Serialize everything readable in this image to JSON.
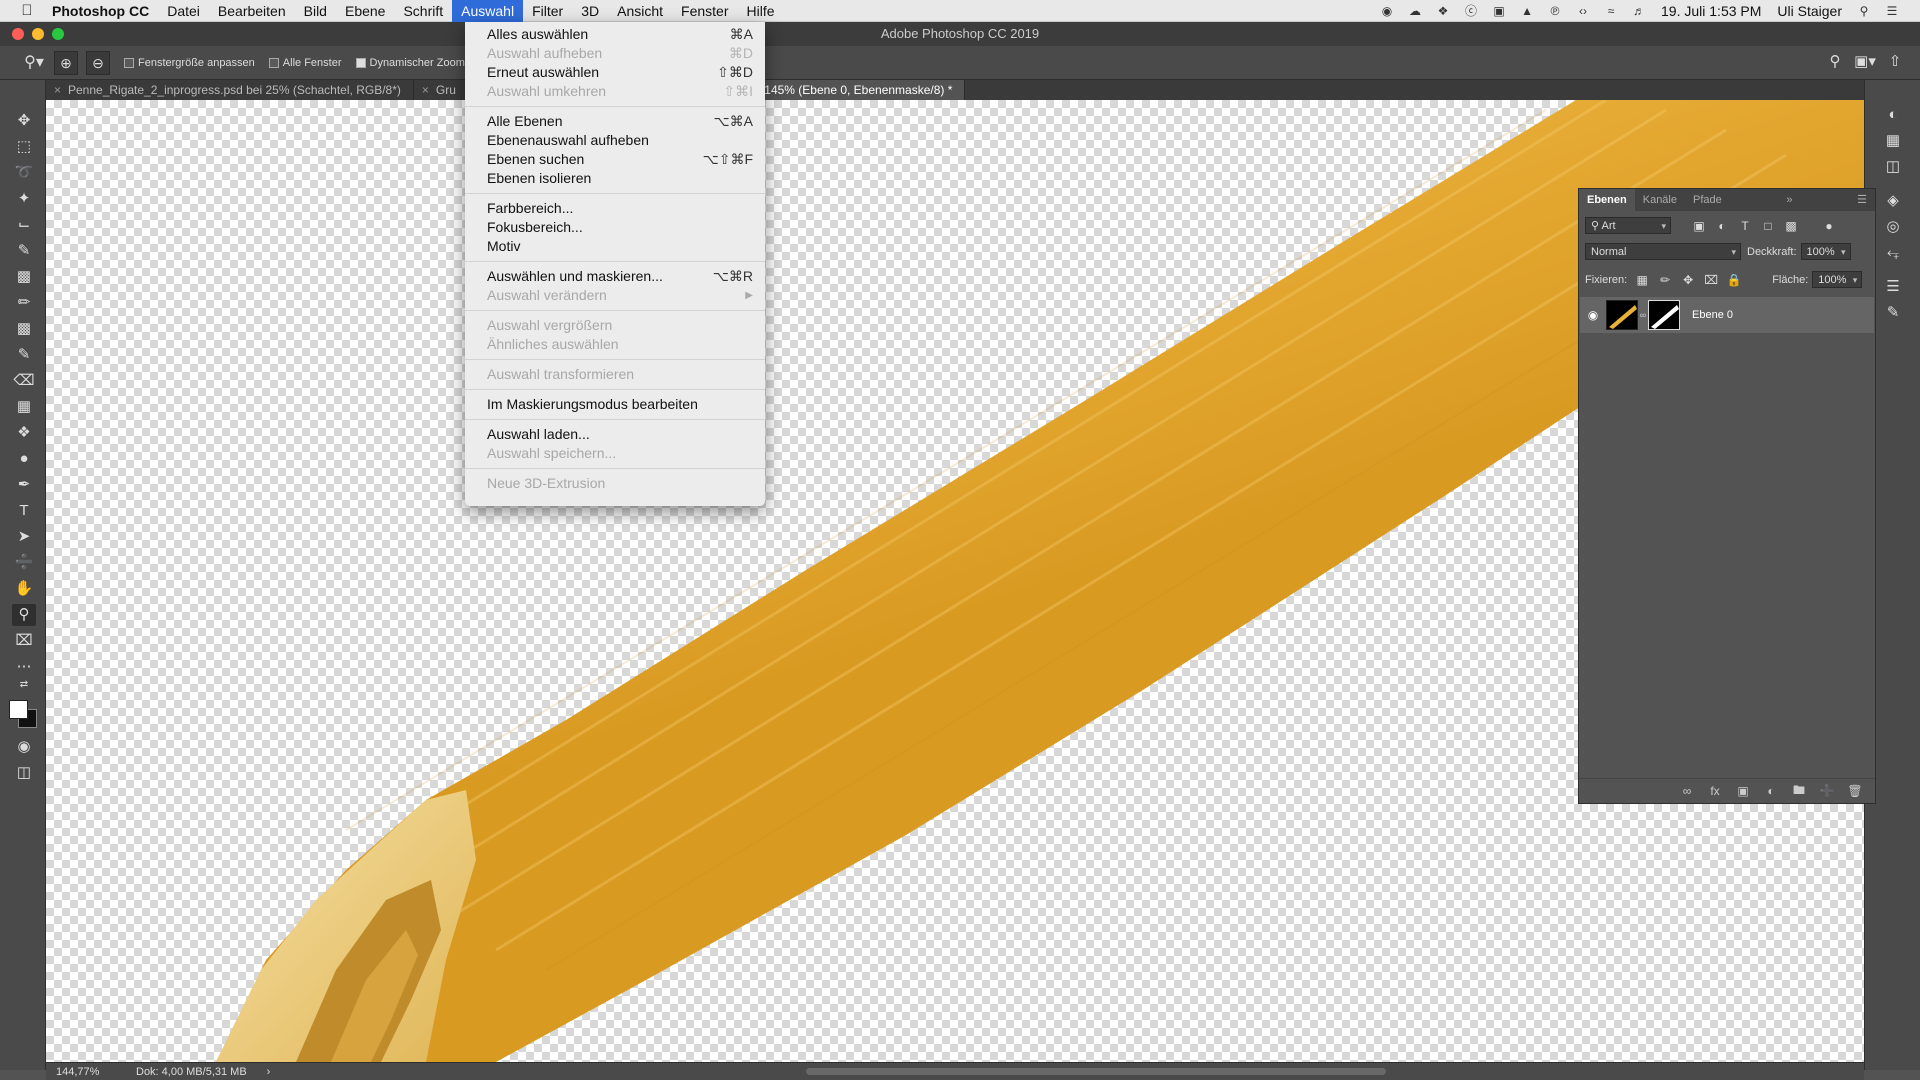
{
  "menubar": {
    "app": "Photoshop CC",
    "items": [
      "Datei",
      "Bearbeiten",
      "Bild",
      "Ebene",
      "Schrift",
      "Auswahl",
      "Filter",
      "3D",
      "Ansicht",
      "Fenster",
      "Hilfe"
    ],
    "datetime": "19. Juli  1:53 PM",
    "user": "Uli Staiger"
  },
  "window": {
    "title": "Adobe Photoshop CC 2019"
  },
  "options": {
    "fit_label": "Fenstergröße anpassen",
    "all_windows_label": "Alle Fenster",
    "scrubby_label": "Dynamischer Zoom"
  },
  "tabs": [
    {
      "label": "Penne_Rigate_2_inprogress.psd bei 25% (Schachtel, RGB/8*)"
    },
    {
      "label": "Gru"
    },
    {
      "label": "16.jpg bei 145% (Ebene 0, Ebenenmaske/8) *"
    }
  ],
  "menu": {
    "items": [
      {
        "label": "Alles auswählen",
        "shortcut": "⌘A",
        "enabled": true
      },
      {
        "label": "Auswahl aufheben",
        "shortcut": "⌘D",
        "enabled": false
      },
      {
        "label": "Erneut auswählen",
        "shortcut": "⇧⌘D",
        "enabled": true
      },
      {
        "label": "Auswahl umkehren",
        "shortcut": "⇧⌘I",
        "enabled": false
      },
      {
        "sep": true
      },
      {
        "label": "Alle Ebenen",
        "shortcut": "⌥⌘A",
        "enabled": true
      },
      {
        "label": "Ebenenauswahl aufheben",
        "shortcut": "",
        "enabled": true
      },
      {
        "label": "Ebenen suchen",
        "shortcut": "⌥⇧⌘F",
        "enabled": true
      },
      {
        "label": "Ebenen isolieren",
        "shortcut": "",
        "enabled": true
      },
      {
        "sep": true
      },
      {
        "label": "Farbbereich...",
        "shortcut": "",
        "enabled": true
      },
      {
        "label": "Fokusbereich...",
        "shortcut": "",
        "enabled": true
      },
      {
        "label": "Motiv",
        "shortcut": "",
        "enabled": true
      },
      {
        "sep": true
      },
      {
        "label": "Auswählen und maskieren...",
        "shortcut": "⌥⌘R",
        "enabled": true
      },
      {
        "label": "Auswahl verändern",
        "shortcut": "",
        "enabled": false,
        "submenu": true
      },
      {
        "sep": true
      },
      {
        "label": "Auswahl vergrößern",
        "shortcut": "",
        "enabled": false
      },
      {
        "label": "Ähnliches auswählen",
        "shortcut": "",
        "enabled": false
      },
      {
        "sep": true
      },
      {
        "label": "Auswahl transformieren",
        "shortcut": "",
        "enabled": false
      },
      {
        "sep": true
      },
      {
        "label": "Im Maskierungsmodus bearbeiten",
        "shortcut": "",
        "enabled": true
      },
      {
        "sep": true
      },
      {
        "label": "Auswahl laden...",
        "shortcut": "",
        "enabled": true
      },
      {
        "label": "Auswahl speichern...",
        "shortcut": "",
        "enabled": false
      },
      {
        "sep": true
      },
      {
        "label": "Neue 3D-Extrusion",
        "shortcut": "",
        "enabled": false
      }
    ]
  },
  "layers_panel": {
    "tabs": [
      "Ebenen",
      "Kanäle",
      "Pfade"
    ],
    "filter_kind": "Art",
    "blend_mode": "Normal",
    "opacity_label": "Deckkraft:",
    "opacity": "100%",
    "lock_label": "Fixieren:",
    "fill_label": "Fläche:",
    "fill": "100%",
    "layer": {
      "name": "Ebene 0"
    }
  },
  "status": {
    "zoom": "144,77%",
    "doc": "Dok: 4,00 MB/5,31 MB"
  },
  "colors": {
    "menu_highlight": "#2f6bd9",
    "pasta": "#e8b13a",
    "app_bg": "#535353"
  }
}
